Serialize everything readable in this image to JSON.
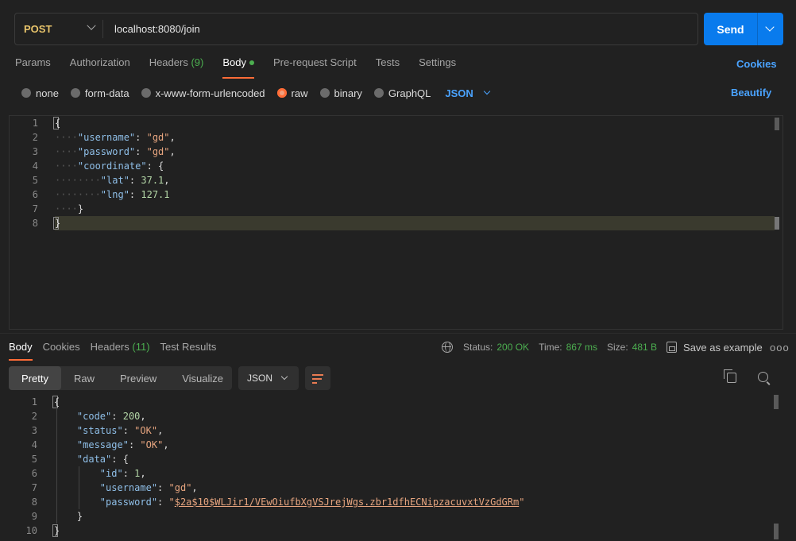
{
  "request": {
    "method": "POST",
    "url": "localhost:8080/join",
    "send_label": "Send"
  },
  "request_tabs": [
    {
      "label": "Params"
    },
    {
      "label": "Authorization"
    },
    {
      "label": "Headers",
      "count": "(9)"
    },
    {
      "label": "Body",
      "active": true
    },
    {
      "label": "Pre-request Script"
    },
    {
      "label": "Tests"
    },
    {
      "label": "Settings"
    }
  ],
  "cookies_label": "Cookies",
  "body_types": [
    "none",
    "form-data",
    "x-www-form-urlencoded",
    "raw",
    "binary",
    "GraphQL"
  ],
  "selected_body_type": "raw",
  "language": "JSON",
  "beautify_label": "Beautify",
  "request_body_lines": [
    "{",
    "    \"username\": \"gd\",",
    "    \"password\": \"gd\",",
    "    \"coordinate\": {",
    "        \"lat\": 37.1,",
    "        \"lng\": 127.1",
    "    }",
    "}"
  ],
  "response_tabs": [
    {
      "label": "Body",
      "active": true
    },
    {
      "label": "Cookies"
    },
    {
      "label": "Headers",
      "count": "(11)"
    },
    {
      "label": "Test Results"
    }
  ],
  "response_meta": {
    "status_label": "Status:",
    "status_value": "200 OK",
    "time_label": "Time:",
    "time_value": "867 ms",
    "size_label": "Size:",
    "size_value": "481 B",
    "save_label": "Save as example",
    "more": "ooo"
  },
  "view_tabs": [
    "Pretty",
    "Raw",
    "Preview",
    "Visualize"
  ],
  "response_format": "JSON",
  "response_body": {
    "code": 200,
    "status": "OK",
    "message": "OK",
    "data": {
      "id": 1,
      "username": "gd",
      "password": "$2a$10$WLJir1/VEwOiufbXgVSJrejWgs.zbr1dfhECNipzacuvxtVzGdGRm"
    }
  },
  "line_numbers": {
    "request": [
      "1",
      "2",
      "3",
      "4",
      "5",
      "6",
      "7",
      "8"
    ],
    "response": [
      "1",
      "2",
      "3",
      "4",
      "5",
      "6",
      "7",
      "8",
      "9",
      "10"
    ]
  },
  "colors": {
    "accent": "#ff6c37",
    "send": "#097bed",
    "method": "#e8c46b",
    "ok": "#4caf50",
    "link": "#4aa3ff"
  }
}
